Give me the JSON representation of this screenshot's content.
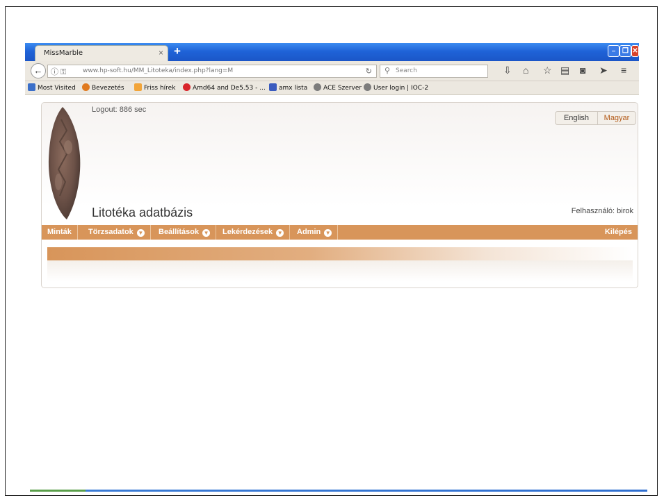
{
  "browser": {
    "tab_title": "MissMarble",
    "tab_close": "×",
    "new_tab": "+",
    "url": "www.hp-soft.hu/MM_Litoteka/index.php?lang=M",
    "search_placeholder": "Search",
    "window_buttons": [
      "minimize",
      "maximize",
      "close"
    ]
  },
  "bookmarks": [
    {
      "label": "Most Visited",
      "icon": "most-visited-icon",
      "color": "#3b6fc9"
    },
    {
      "label": "Bevezetés",
      "icon": "firefox-icon",
      "color": "#e07a1f"
    },
    {
      "label": "Friss hírek",
      "icon": "rss-icon",
      "color": "#f2a53a"
    },
    {
      "label": "Amd64 and De5.53 - ...",
      "icon": "amd-icon",
      "color": "#d8242b"
    },
    {
      "label": "amx lista",
      "icon": "amx-icon",
      "color": "#3a5bbf"
    },
    {
      "label": "ACE Szerver",
      "icon": "globe-icon",
      "color": "#7c7c7c"
    },
    {
      "label": "User login | IOC-2",
      "icon": "globe-icon",
      "color": "#7c7c7c"
    }
  ],
  "page": {
    "logout": "Logout: 886 sec",
    "lang_en": "English",
    "lang_hu": "Magyar",
    "title": "Litotéka adatbázis",
    "user": "Felhasználó: birok",
    "menu": [
      "Minták",
      "Törzsadatok",
      "Beállítások",
      "Lekérdezések",
      "Admin"
    ],
    "exit": "Kilépés"
  },
  "colors": {
    "accent": "#d8955a",
    "titlebar": "#1f63d8",
    "lang_active": "#b35a18"
  }
}
